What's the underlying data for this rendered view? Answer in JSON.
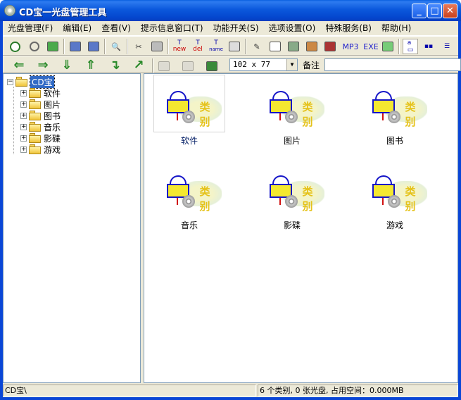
{
  "window": {
    "title": "CD宝一光盘管理工具"
  },
  "menu": [
    {
      "label": "光盘管理(F)"
    },
    {
      "label": "编辑(E)"
    },
    {
      "label": "查看(V)"
    },
    {
      "label": "提示信息窗口(T)"
    },
    {
      "label": "功能开关(S)"
    },
    {
      "label": "选项设置(O)"
    },
    {
      "label": "特殊服务(B)"
    },
    {
      "label": "帮助(H)"
    }
  ],
  "toolbar": {
    "mp3_label": "MP3",
    "exe_label": "EXE",
    "new_label": "new",
    "del_label": "del",
    "name_label": "name"
  },
  "view": {
    "thumb_size": "102 x 77",
    "note_label": "备注",
    "note_value": ""
  },
  "tree": {
    "root": "CD宝",
    "children": [
      "软件",
      "图片",
      "图书",
      "音乐",
      "影碟",
      "游戏"
    ]
  },
  "categories": [
    {
      "label": "软件",
      "thumb_text": "类别"
    },
    {
      "label": "图片",
      "thumb_text": "类别"
    },
    {
      "label": "图书",
      "thumb_text": "类别"
    },
    {
      "label": "音乐",
      "thumb_text": "类别"
    },
    {
      "label": "影碟",
      "thumb_text": "类别"
    },
    {
      "label": "游戏",
      "thumb_text": "类别"
    }
  ],
  "status": {
    "path": "CD宝\\",
    "summary": "6 个类别, 0 张光盘, 占用空间：0.000MB"
  }
}
